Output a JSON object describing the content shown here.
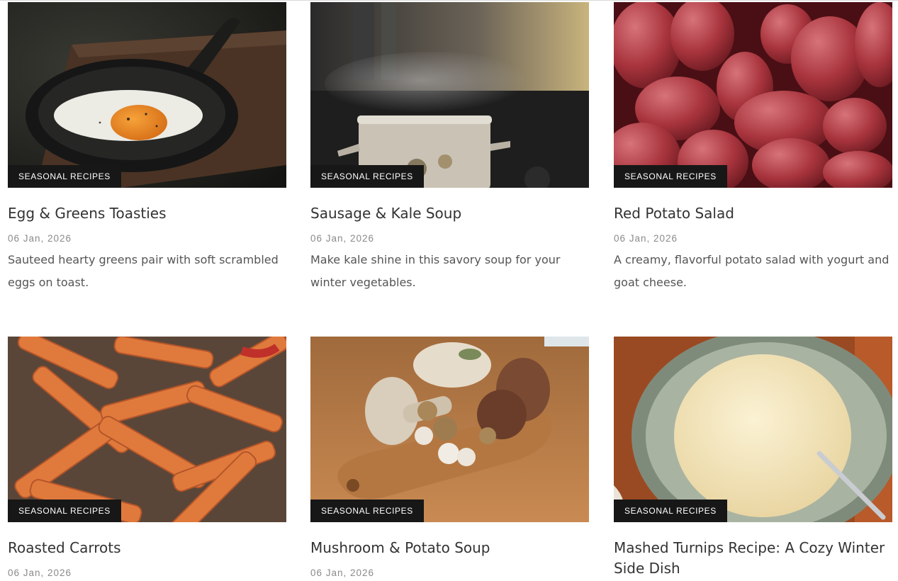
{
  "posts": [
    {
      "image_alt": "egg in cast iron skillet",
      "category": "SEASONAL RECIPES",
      "title": "Egg & Greens Toasties",
      "date": "06 Jan, 2026",
      "excerpt": "Sauteed hearty greens pair with soft scrambled eggs on toast."
    },
    {
      "image_alt": "steaming soup pot",
      "category": "SEASONAL RECIPES",
      "title": "Sausage & Kale Soup",
      "date": "06 Jan, 2026",
      "excerpt": "Make kale shine in this savory soup for your winter vegetables."
    },
    {
      "image_alt": "red potatoes",
      "category": "SEASONAL RECIPES",
      "title": "Red Potato Salad",
      "date": "06 Jan, 2026",
      "excerpt": "A creamy, flavorful potato salad with yogurt and goat cheese."
    },
    {
      "image_alt": "roasted carrot sticks",
      "category": "SEASONAL RECIPES",
      "title": "Roasted Carrots",
      "date": "06 Jan, 2026",
      "excerpt": ""
    },
    {
      "image_alt": "mushrooms on cutting board",
      "category": "SEASONAL RECIPES",
      "title": "Mushroom & Potato Soup",
      "date": "06 Jan, 2026",
      "excerpt": ""
    },
    {
      "image_alt": "bowl of mashed turnips",
      "category": "SEASONAL RECIPES",
      "title": "Mashed Turnips Recipe: A Cozy Winter Side Dish",
      "date": "",
      "excerpt": ""
    }
  ]
}
